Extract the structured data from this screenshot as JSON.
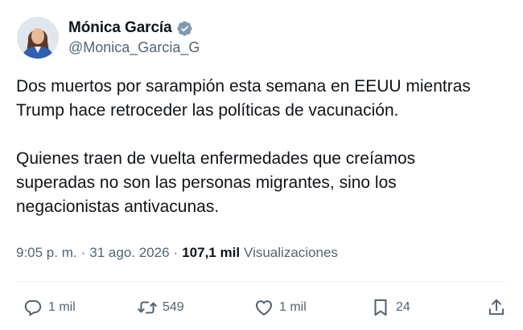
{
  "author": {
    "display_name": "Mónica García",
    "handle": "@Monica_Garcia_G",
    "verified": true,
    "verified_color": "#829aab"
  },
  "tweet": {
    "paragraphs": [
      "Dos muertos por sarampión esta semana en EEUU mientras\nTrump hace retroceder las políticas de vacunación.",
      "Quienes traen de vuelta enfermedades que creíamos\nsuperadas no son las personas migrantes, sino los\nnegacionistas antivacunas."
    ]
  },
  "meta": {
    "time": "9:05 p. m.",
    "separator": "·",
    "date": "31 ago. 2026",
    "views_count": "107,1 mil",
    "views_label": "Visualizaciones"
  },
  "actions": {
    "reply": {
      "icon": "reply-icon",
      "count": "1 mil"
    },
    "retweet": {
      "icon": "retweet-icon",
      "count": "549"
    },
    "like": {
      "icon": "heart-icon",
      "count": "1 mil"
    },
    "bookmark": {
      "icon": "bookmark-icon",
      "count": "24"
    },
    "share": {
      "icon": "share-icon"
    }
  },
  "colors": {
    "text_primary": "#0f1419",
    "text_secondary": "#536471",
    "divider": "#eff3f4"
  }
}
